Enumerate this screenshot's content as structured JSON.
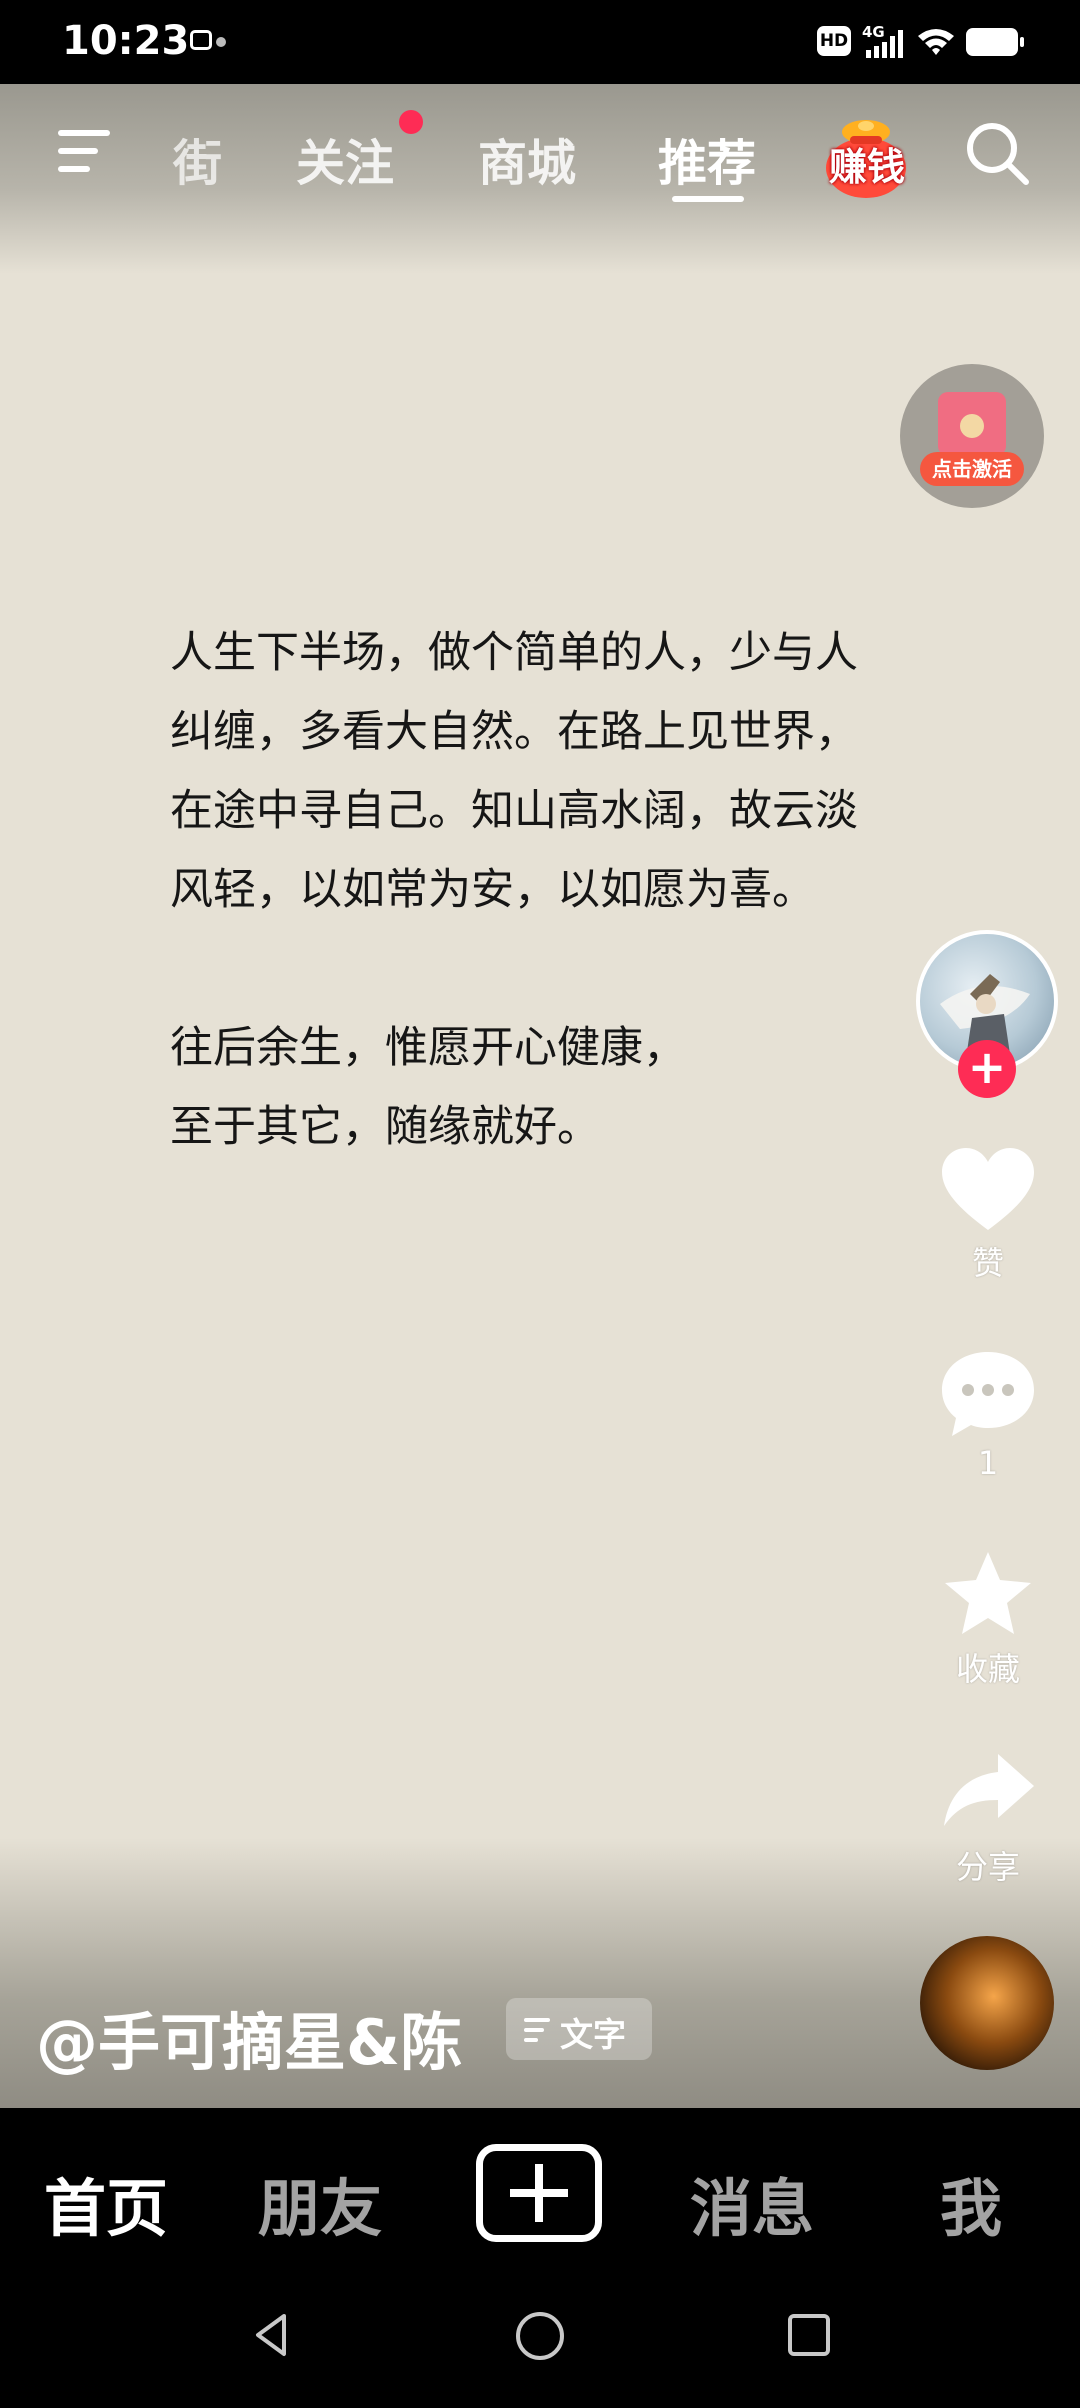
{
  "status_bar": {
    "time": "10:23",
    "hd_label": "HD",
    "network_label": "4G"
  },
  "top_nav": {
    "tabs": [
      {
        "label": "街"
      },
      {
        "label": "关注"
      },
      {
        "label": "商城"
      },
      {
        "label": "推荐"
      }
    ],
    "active_tab": "推荐",
    "earn_label": "赚钱"
  },
  "activate_badge": {
    "label": "点击激活"
  },
  "post": {
    "paragraph_1": [
      "人生下半场，做个简单的人，少与人",
      "纠缠，多看大自然。在路上见世界，",
      "在途中寻自己。知山高水阔，故云淡",
      "风轻，以如常为安，以如愿为喜。"
    ],
    "paragraph_2": [
      "往后余生，惟愿开心健康，",
      "至于其它，随缘就好。"
    ],
    "author": "@手可摘星&陈",
    "tag_label": "文字"
  },
  "actions": {
    "like_label": "赞",
    "comment_count": "1",
    "collect_label": "收藏",
    "share_label": "分享"
  },
  "bottom_nav": {
    "home": "首页",
    "friends": "朋友",
    "messages": "消息",
    "me": "我"
  },
  "colors": {
    "background": "#e6e1d5",
    "accent_red": "#fe2c55",
    "text_dark": "#161616"
  }
}
